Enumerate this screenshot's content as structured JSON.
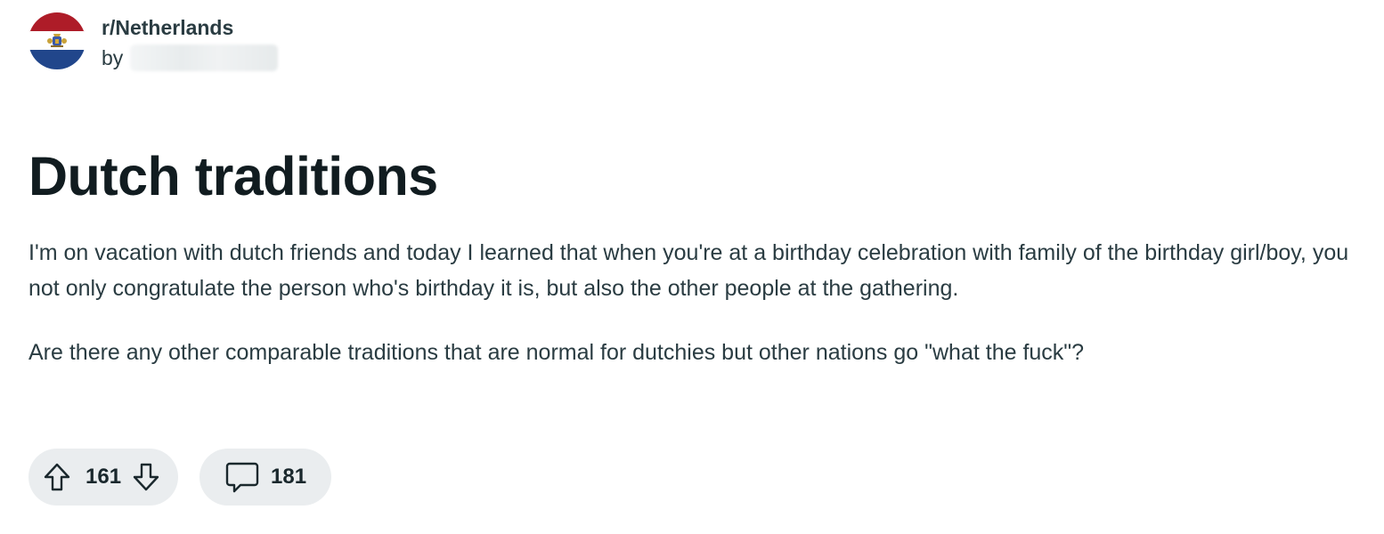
{
  "post": {
    "subreddit": "r/Netherlands",
    "byline_prefix": "by",
    "title": "Dutch traditions",
    "paragraphs": [
      "I'm on vacation with dutch friends and today I learned that when you're at a birthday celebration with family of the birthday girl/boy, you not only congratulate the person who's birthday it is, but also the other people at the gathering.",
      "Are there any other comparable traditions that are normal for dutchies but other nations go \"what the fuck\"?"
    ],
    "votes": "161",
    "comments": "181"
  },
  "icons": {
    "avatar": "netherlands-flag-with-coat-of-arms",
    "upvote": "arrow-up-outline",
    "downvote": "arrow-down-outline",
    "comment": "speech-bubble-outline"
  },
  "colors": {
    "flag_red": "#ae1c28",
    "flag_white": "#ffffff",
    "flag_blue": "#21468b",
    "pill_background": "#eaedef",
    "title_text": "#111c20",
    "body_text": "#2a3c42"
  }
}
